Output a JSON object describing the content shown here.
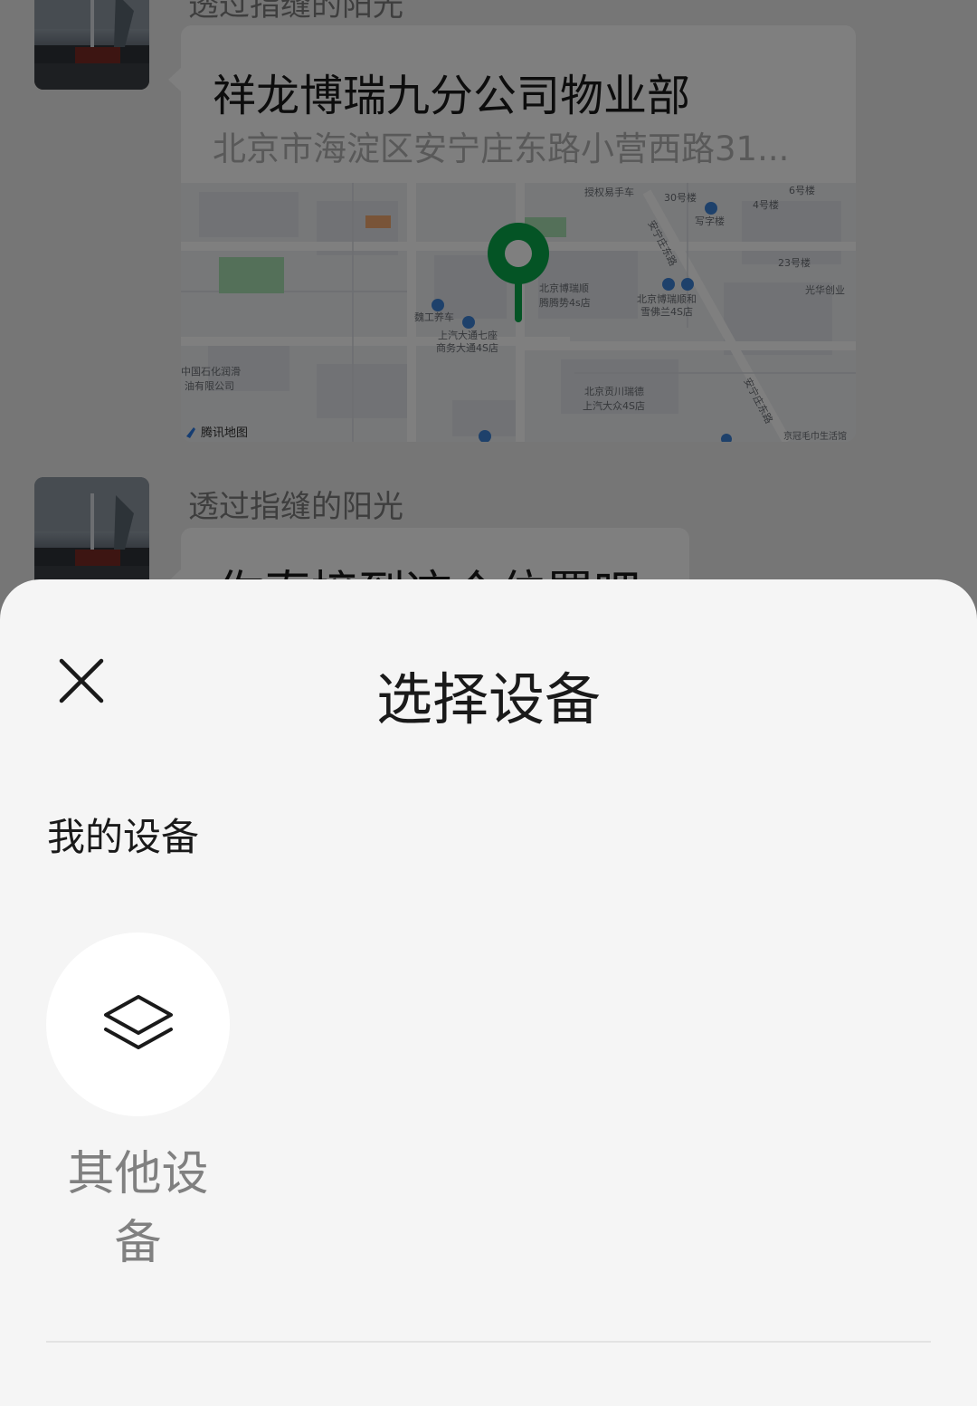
{
  "chat": {
    "messages": [
      {
        "sender": "透过指缝的阳光",
        "type": "location",
        "location_name": "祥龙博瑞九分公司物业部",
        "location_address": "北京市海淀区安宁庄东路小营西路31...",
        "map": {
          "attribution": "腾讯地图",
          "labels": {
            "shop_top": "授权易手车",
            "bldg_30": "30号楼",
            "bldg_4": "4号楼",
            "bldg_6": "6号楼",
            "office": "写字楼",
            "bldg_23": "23号楼",
            "guanghua": "光华创业",
            "road_top": "安宁庄东路",
            "road_bottom": "安宁庄东路",
            "boruishun_line1": "北京博瑞顺",
            "boruishun_line2": "腾腾势4s店",
            "boruishun_jl_line1": "北京博瑞顺和",
            "boruishun_jl_line2": "雪佛兰4S店",
            "weigong": "魏工养车",
            "saic_line1": "上汽大通七座",
            "saic_line2": "商务大通4S店",
            "sinopec_line1": "中国石化润滑",
            "sinopec_line2": "油有限公司",
            "gongchuan_line1": "北京贡川瑞德",
            "gongchuan_line2": "上汽大众4S店",
            "guanmao": "京冠毛巾生活馆"
          },
          "pin_color": "#08a84a"
        }
      },
      {
        "sender": "透过指缝的阳光",
        "type": "text",
        "text": "你直接到这个位置吧"
      }
    ]
  },
  "sheet": {
    "title": "选择设备",
    "section_label": "我的设备",
    "devices": [
      {
        "label": "其他设备",
        "icon": "layers-icon"
      }
    ]
  }
}
